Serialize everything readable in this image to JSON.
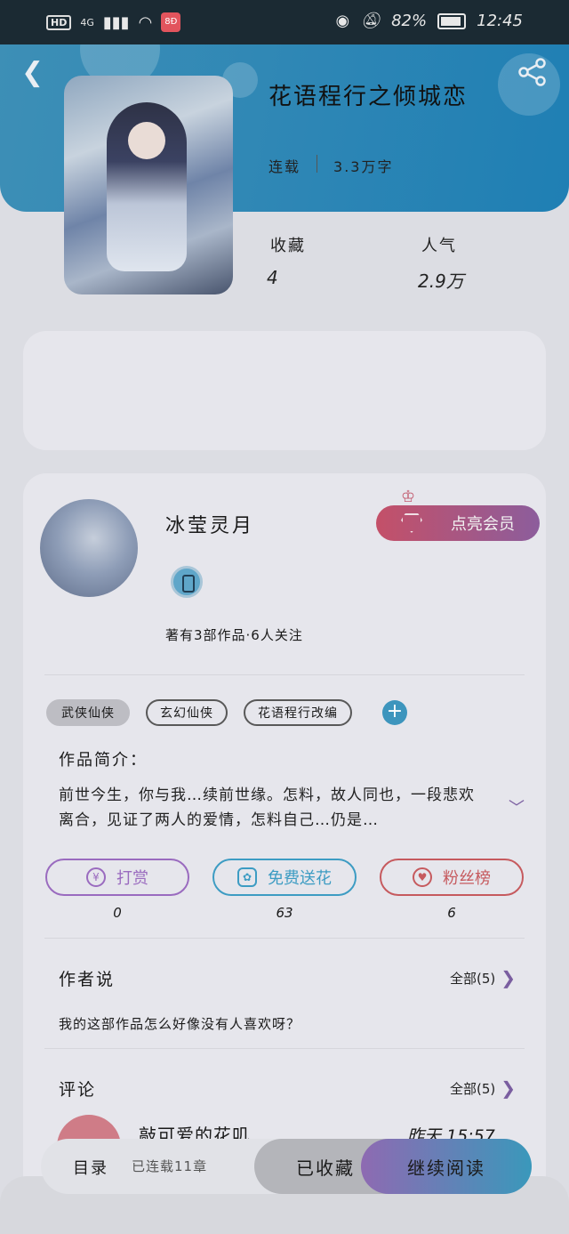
{
  "status_bar": {
    "network": "4G",
    "battery": "82%",
    "time": "12:45",
    "hd": "HD",
    "app_badge": "8Ð"
  },
  "book": {
    "title": "花语程行之倾城恋",
    "status": "连载",
    "word_count": "3.3万字",
    "stats": [
      {
        "label": "收藏",
        "value": "4"
      },
      {
        "label": "人气",
        "value": "2.9万"
      }
    ]
  },
  "author": {
    "name": "冰莹灵月",
    "works_line": "著有3部作品·6人关注",
    "vip_button": "点亮会员"
  },
  "tags": [
    "武侠仙侠",
    "玄幻仙侠",
    "花语程行改编"
  ],
  "intro": {
    "heading": "作品简介：",
    "text": "前世今生，你与我…续前世缘。怎料，故人同也，一段悲欢离合，见证了两人的爱情，怎料自己…仍是…"
  },
  "actions": [
    {
      "label": "打赏",
      "count": "0",
      "icon": "yen-coin-icon",
      "color": "#9a6bbf"
    },
    {
      "label": "免费送花",
      "count": "63",
      "icon": "flower-icon",
      "color": "#3d9cc3"
    },
    {
      "label": "粉丝榜",
      "count": "6",
      "icon": "fan-user-icon",
      "color": "#c65a5e"
    }
  ],
  "author_says": {
    "heading": "作者说",
    "more": "全部(5)",
    "text": "我的这部作品怎么好像没有人喜欢呀？"
  },
  "comments": {
    "heading": "评论",
    "more": "全部(5)",
    "first": {
      "name": "敲可爱的花叽",
      "time": "昨天 15:57"
    }
  },
  "bottom_bar": {
    "toc": "目录",
    "toc_sub": "已连载11章",
    "favorited": "已收藏",
    "continue": "继续阅读"
  }
}
